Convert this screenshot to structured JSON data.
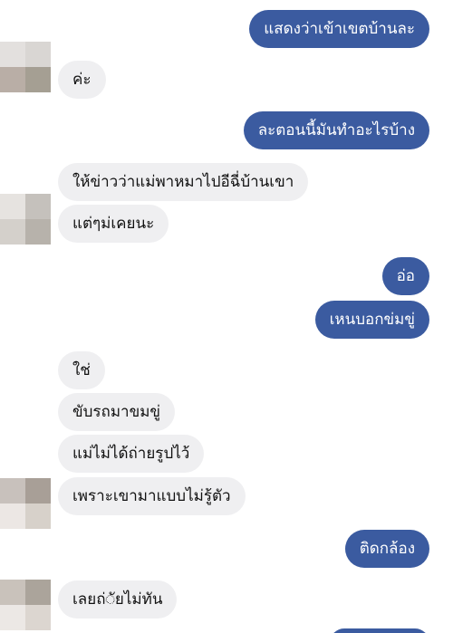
{
  "messages": [
    {
      "side": "out",
      "text": "แสดงว่าเข้าเขตบ้านละ"
    },
    {
      "side": "in",
      "text": "ค่ะ"
    },
    {
      "side": "out",
      "text": "ละตอนนี้มันทำอะไรบ้าง"
    },
    {
      "side": "in",
      "text": "ให้ข่าวว่าแม่พาหมาไปอีฉี่บ้านเขา"
    },
    {
      "side": "in",
      "text": "แต่ๆม่เคยนะ"
    },
    {
      "side": "out",
      "text": "อ่อ"
    },
    {
      "side": "out",
      "text": "เหนบอกข่มขู่"
    },
    {
      "side": "in",
      "text": "ใช่"
    },
    {
      "side": "in",
      "text": "ขับรถมาขมขู่"
    },
    {
      "side": "in",
      "text": "แม่ไม่ได้ถ่ายรูปไว้"
    },
    {
      "side": "in",
      "text": "เพราะเขามาแบบไม่รู้ตัว"
    },
    {
      "side": "out",
      "text": "ติดกล้อง"
    },
    {
      "side": "in",
      "text": "เลยถ่◌ัยไม่ทัน"
    }
  ],
  "colors": {
    "outgoing_bubble": "#3b5ba0",
    "incoming_bubble": "#efeff1"
  }
}
